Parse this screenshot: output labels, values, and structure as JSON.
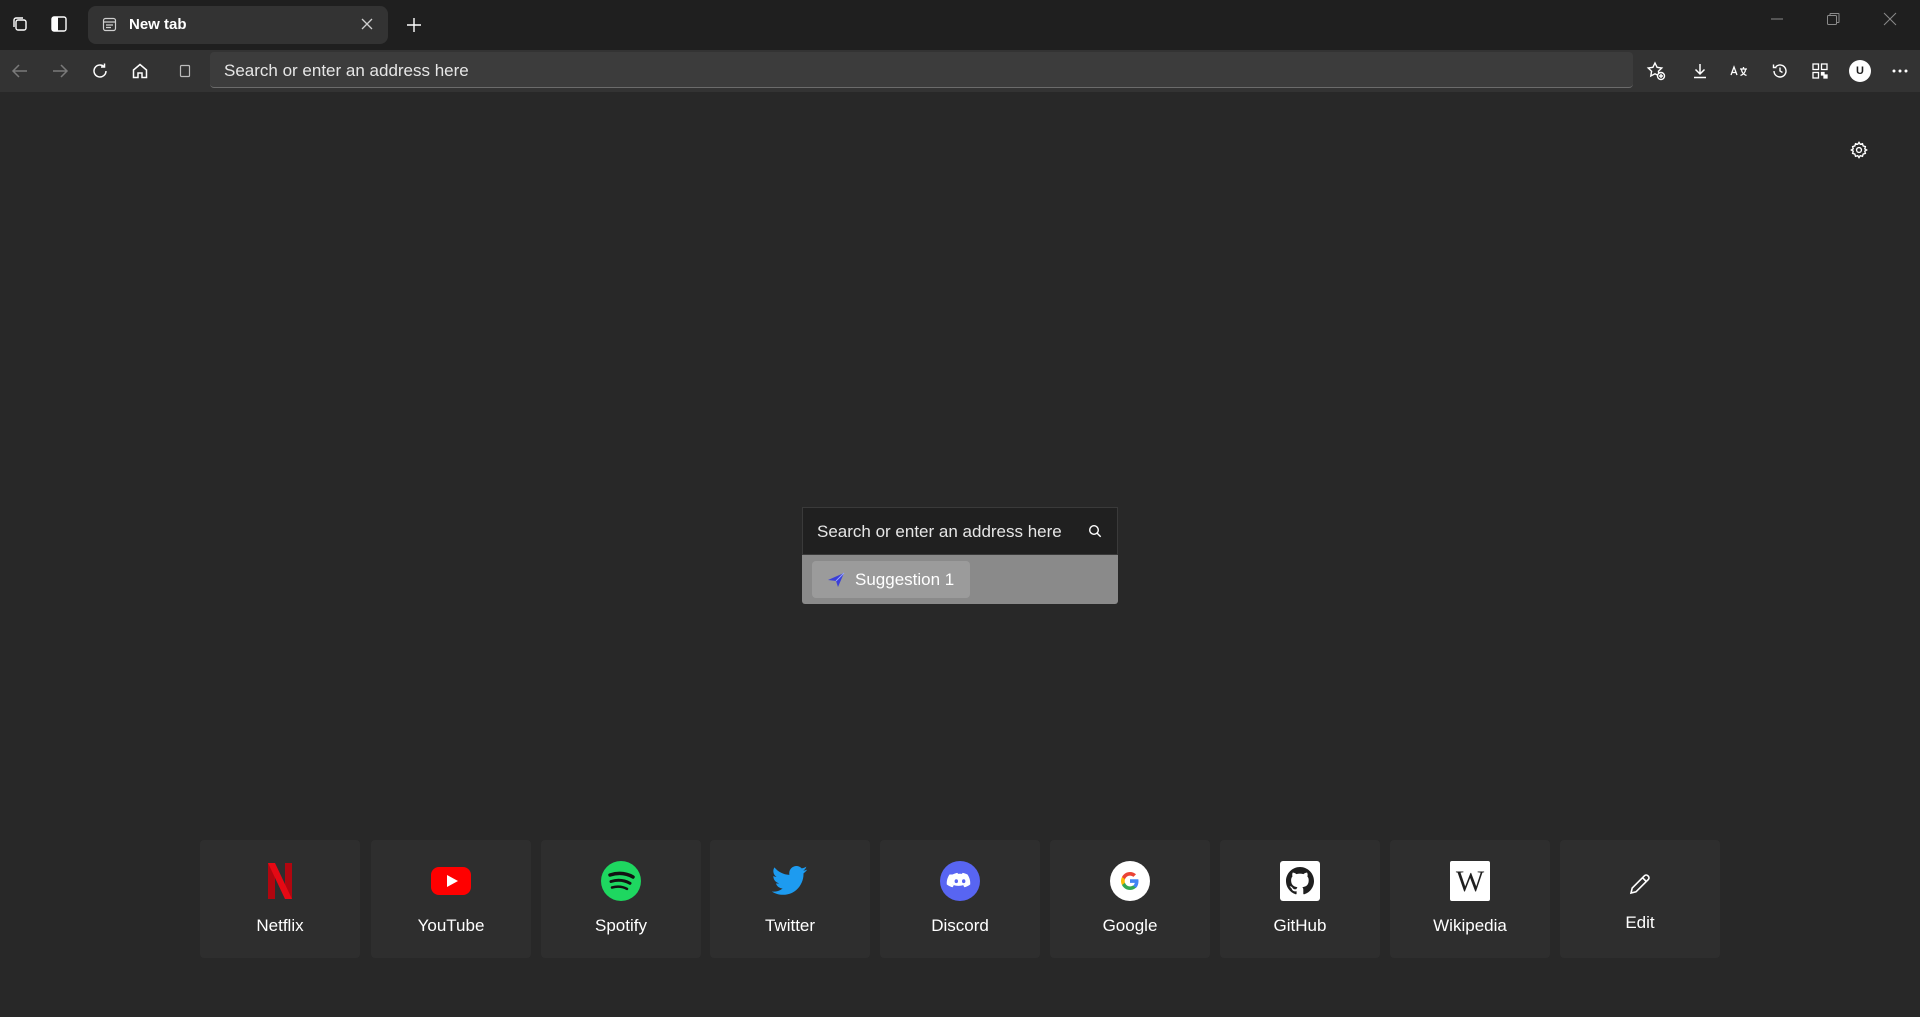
{
  "tabs": [
    {
      "title": "New tab"
    }
  ],
  "address_bar": {
    "placeholder": "Search or enter an address here",
    "value": ""
  },
  "profile": {
    "initial": "U"
  },
  "search": {
    "placeholder": "Search or enter an address here",
    "suggestions": [
      {
        "label": "Suggestion 1",
        "icon": "paper-plane-icon"
      }
    ]
  },
  "quick_links": [
    {
      "label": "Netflix",
      "icon": "netflix-icon"
    },
    {
      "label": "YouTube",
      "icon": "youtube-icon"
    },
    {
      "label": "Spotify",
      "icon": "spotify-icon"
    },
    {
      "label": "Twitter",
      "icon": "twitter-icon"
    },
    {
      "label": "Discord",
      "icon": "discord-icon"
    },
    {
      "label": "Google",
      "icon": "google-icon"
    },
    {
      "label": "GitHub",
      "icon": "github-icon"
    },
    {
      "label": "Wikipedia",
      "icon": "wikipedia-icon"
    },
    {
      "label": "Edit",
      "icon": "pencil-icon"
    }
  ],
  "colors": {
    "background": "#282828",
    "titlebar": "#1f1f1f",
    "toolbar": "#333333",
    "netflix": "#e50914",
    "youtube": "#ff0000",
    "spotify": "#1ed760",
    "twitter": "#1d9bf0",
    "discord": "#5865f2"
  }
}
